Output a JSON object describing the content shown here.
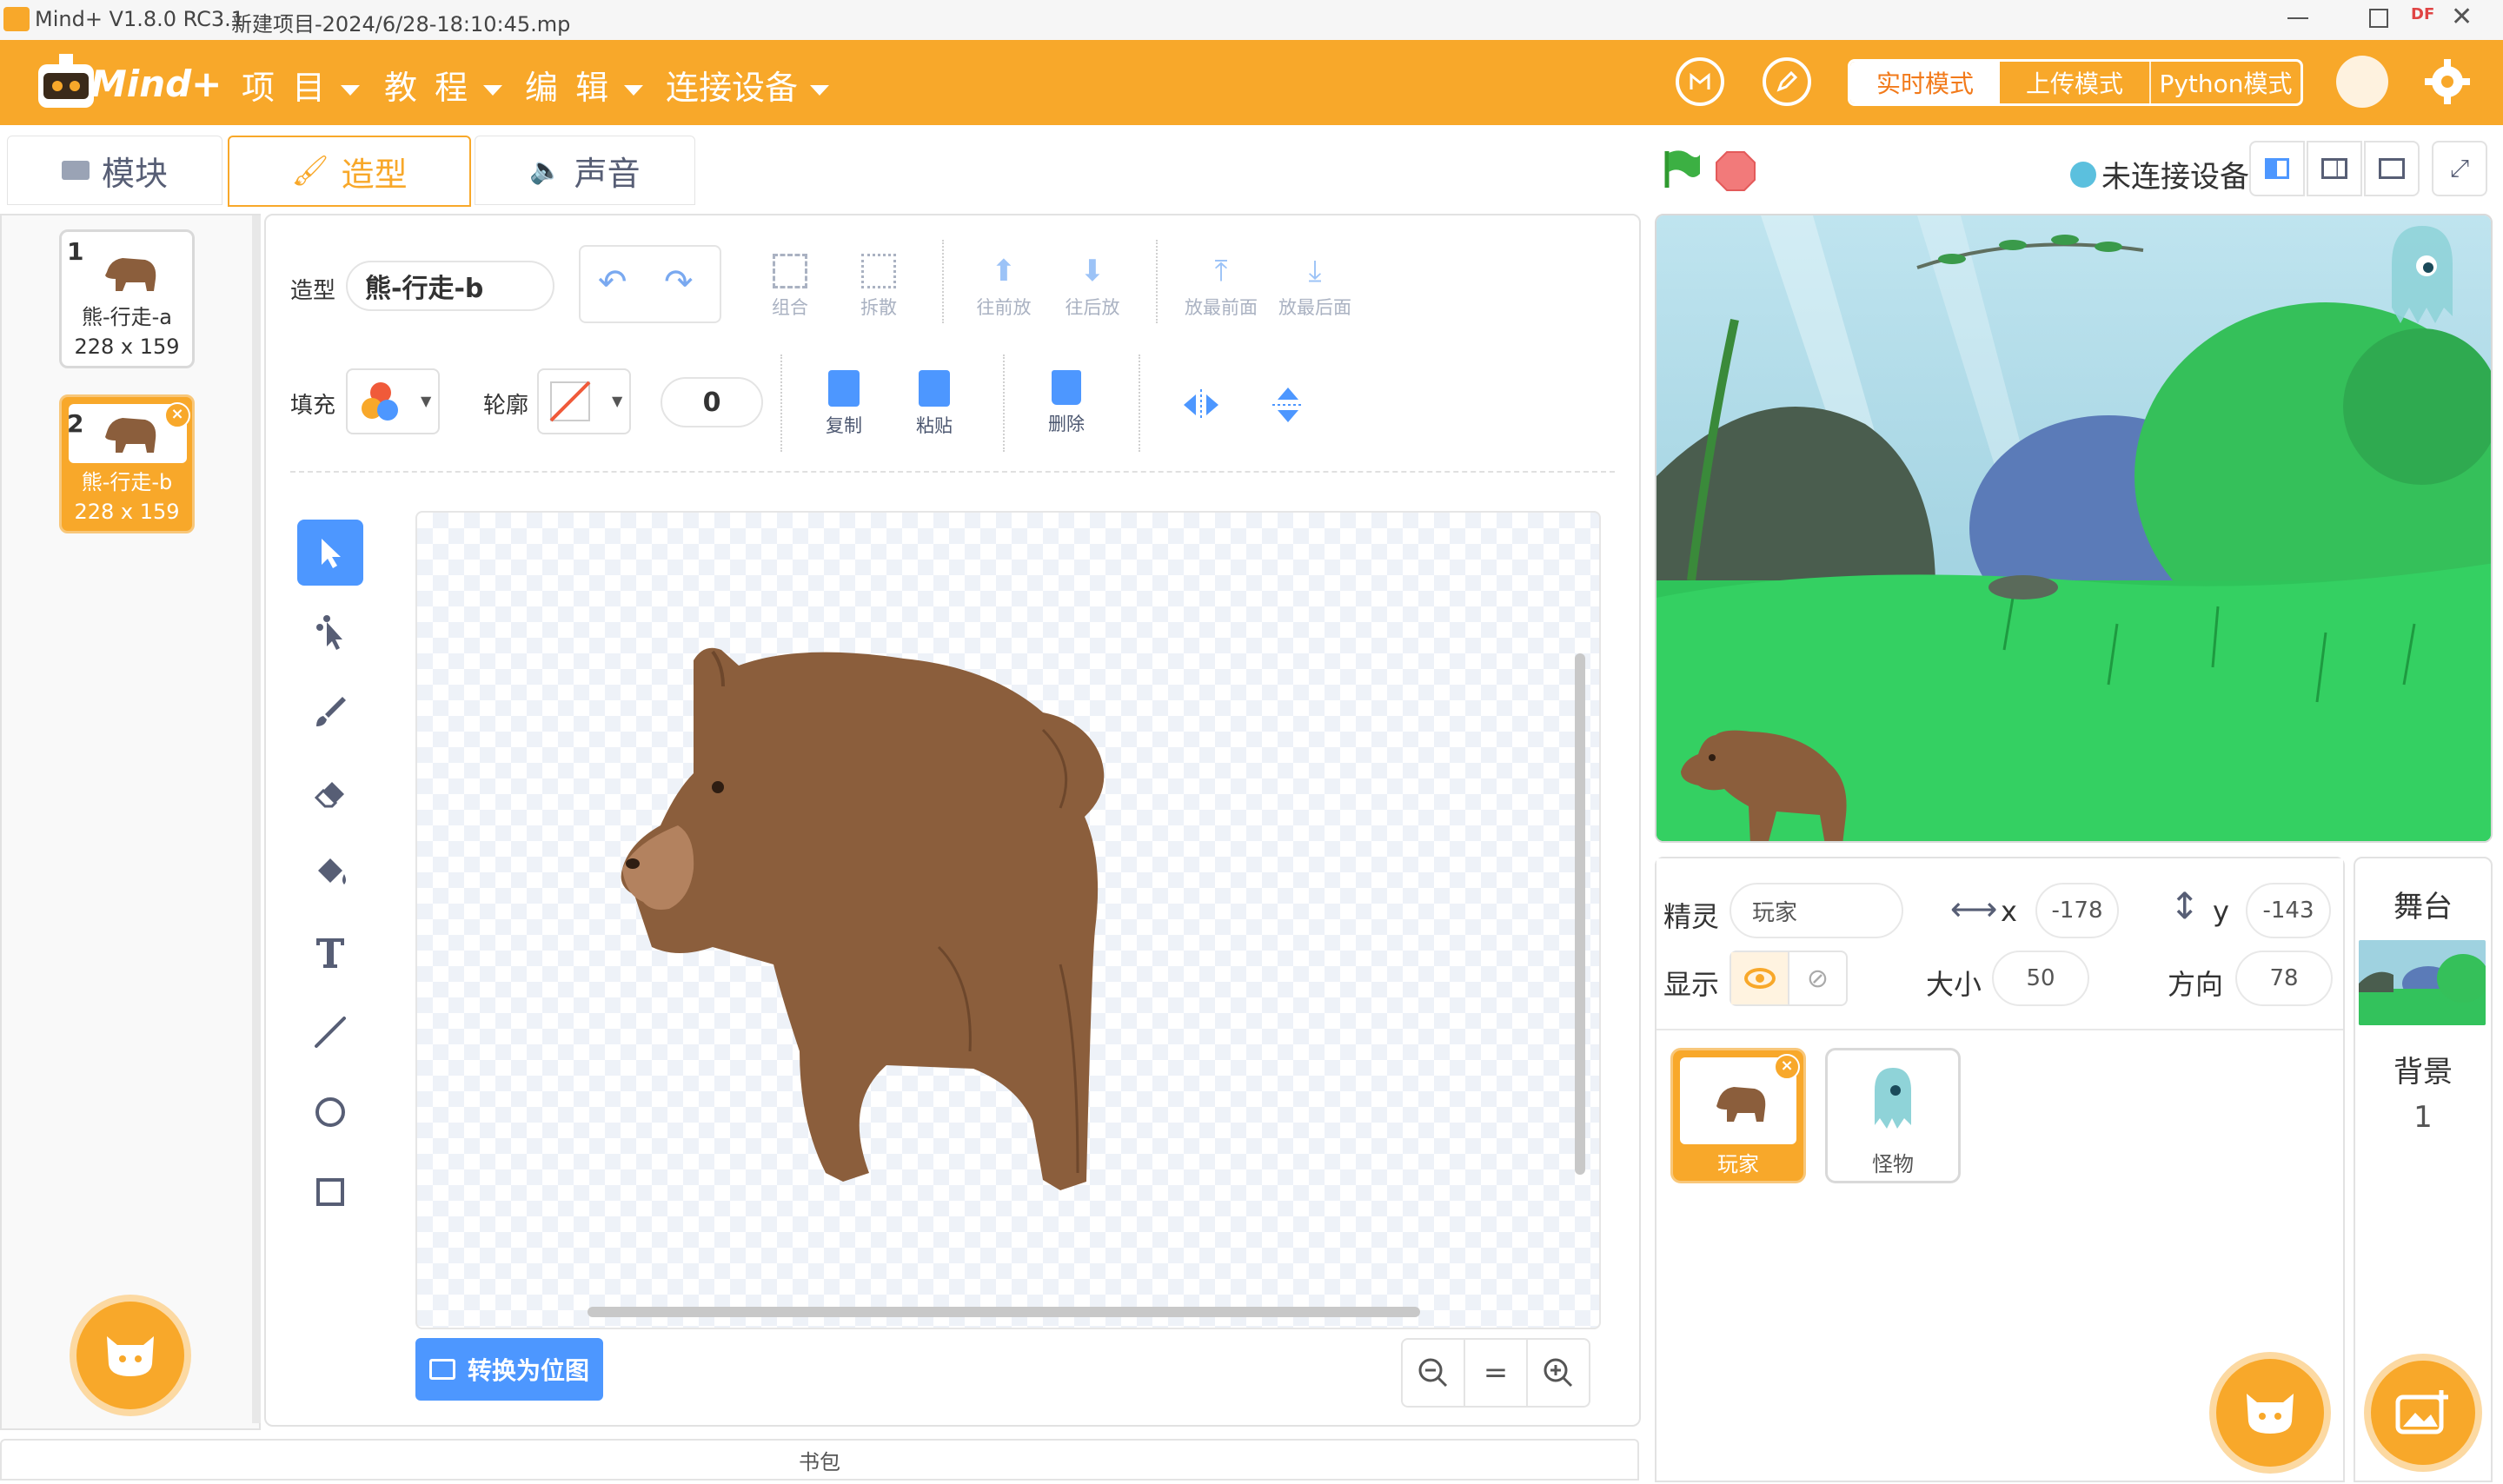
{
  "titlebar": {
    "app": "Mind+ V1.8.0 RC3.1",
    "file": "新建项目-2024/6/28-18:10:45.mp",
    "badge": "DF"
  },
  "menubar": {
    "logo": "Mind+",
    "items": [
      "项 目",
      "教 程",
      "编 辑",
      "连接设备"
    ],
    "modes": [
      "实时模式",
      "上传模式",
      "Python模式"
    ],
    "active_mode": "实时模式"
  },
  "tabs": [
    {
      "label": "模块",
      "icon": "blocks-icon"
    },
    {
      "label": "造型",
      "icon": "brush-icon"
    },
    {
      "label": "声音",
      "icon": "speaker-icon"
    }
  ],
  "costumes": [
    {
      "index": "1",
      "name": "熊-行走-a",
      "size": "228 x 159"
    },
    {
      "index": "2",
      "name": "熊-行走-b",
      "size": "228 x 159"
    }
  ],
  "paint_editor": {
    "costume_label": "造型",
    "costume_name": "熊-行走-b",
    "fill_label": "填充",
    "outline_label": "轮廓",
    "outline_width": "0",
    "toolbar": {
      "group": "组合",
      "ungroup": "拆散",
      "forward": "往前放",
      "backward": "往后放",
      "front": "放最前面",
      "back": "放最后面",
      "copy": "复制",
      "paste": "粘贴",
      "delete": "删除"
    },
    "convert_button": "转换为位图",
    "zoom_reset": "="
  },
  "backpack": "书包",
  "stage_controls": {
    "device_status": "未连接设备"
  },
  "sprite_info": {
    "sprite_label": "精灵",
    "sprite_name": "玩家",
    "x_label": "x",
    "x": "-178",
    "y_label": "y",
    "y": "-143",
    "show_label": "显示",
    "size_label": "大小",
    "size": "50",
    "direction_label": "方向",
    "direction": "78"
  },
  "sprites": [
    {
      "name": "玩家"
    },
    {
      "name": "怪物"
    }
  ],
  "stage_panel": {
    "title": "舞台",
    "backdrop_label": "背景",
    "backdrop_count": "1"
  },
  "colors": {
    "accent": "#f8a82a",
    "active_tool": "#4d97ff",
    "bear": "#8b5e3c"
  }
}
